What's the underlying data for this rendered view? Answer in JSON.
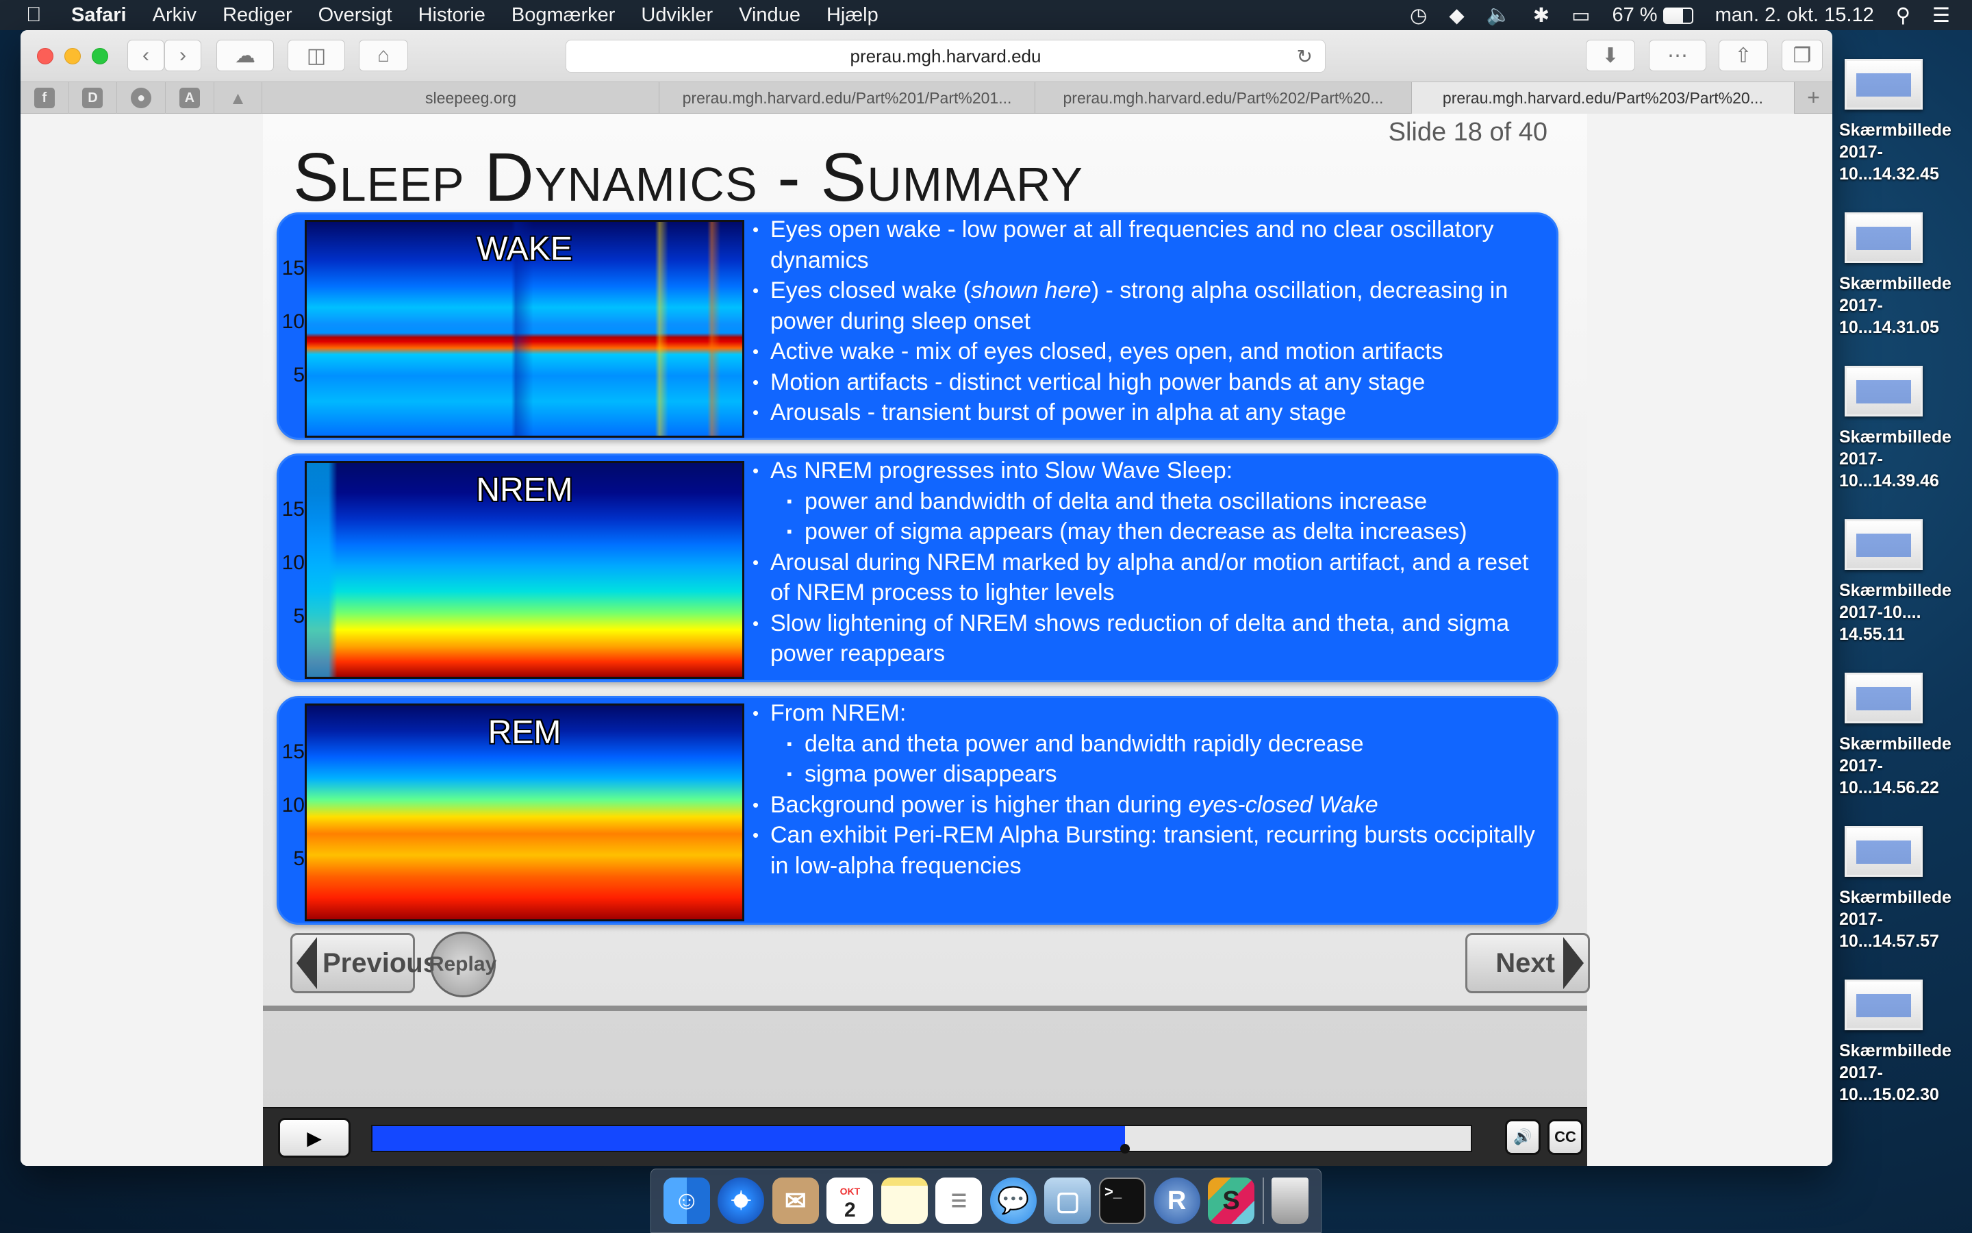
{
  "menubar": {
    "apple": "",
    "app": "Safari",
    "items": [
      "Arkiv",
      "Rediger",
      "Oversigt",
      "Historie",
      "Bogmærker",
      "Udvikler",
      "Vindue",
      "Hjælp"
    ],
    "battery": "67 %",
    "clock": "man. 2. okt. 15.12"
  },
  "browser": {
    "url": "prerau.mgh.harvard.edu",
    "tabs": [
      {
        "label": "sleepeeg.org"
      },
      {
        "label": "prerau.mgh.harvard.edu/Part%201/Part%201..."
      },
      {
        "label": "prerau.mgh.harvard.edu/Part%202/Part%20..."
      },
      {
        "label": "prerau.mgh.harvard.edu/Part%203/Part%20..."
      }
    ],
    "pinned": [
      "f",
      "D",
      "",
      "A",
      ""
    ]
  },
  "slide": {
    "counter": "Slide 18 of 40",
    "title": "Sleep Dynamics - Summary",
    "yticks": [
      "15",
      "10",
      "5"
    ],
    "panels": [
      {
        "label": "WAKE",
        "bullets": [
          {
            "text": "Eyes open wake - low power at all frequencies and no clear oscillatory dynamics"
          },
          {
            "pre": "Eyes closed wake (",
            "em": "shown here",
            "post": ") - strong alpha oscillation, decreasing in power during sleep onset"
          },
          {
            "text": "Active wake - mix of eyes closed, eyes open, and motion artifacts"
          },
          {
            "text": "Motion artifacts - distinct vertical high power bands at any stage"
          },
          {
            "text": "Arousals - transient burst of power in alpha at any stage"
          }
        ]
      },
      {
        "label": "NREM",
        "bullets": [
          {
            "text": "As NREM progresses into Slow Wave Sleep:"
          },
          {
            "text": "power and bandwidth of delta and theta oscillations increase",
            "sub": true
          },
          {
            "text": "power of sigma appears (may then decrease as delta increases)",
            "sub": true
          },
          {
            "text": "Arousal during NREM marked by alpha and/or motion artifact, and a reset of NREM process to lighter levels"
          },
          {
            "text": "Slow lightening of NREM shows reduction of delta and theta, and sigma power reappears"
          }
        ]
      },
      {
        "label": "REM",
        "bullets": [
          {
            "text": "From NREM:"
          },
          {
            "text": "delta and theta power and bandwidth rapidly decrease",
            "sub": true
          },
          {
            "text": "sigma power disappears",
            "sub": true
          },
          {
            "pre": "Background power is higher than during ",
            "em": "eyes-closed Wake",
            "post": ""
          },
          {
            "text": "Can exhibit Peri-REM Alpha Bursting: transient, recurring bursts occipitally in low-alpha frequencies"
          }
        ]
      }
    ],
    "previous_label": "Previous",
    "replay_label": "Replay",
    "next_label": "Next"
  },
  "controls": {
    "progress": 0.685,
    "cc_label": "CC"
  },
  "desktop_icons": [
    {
      "line1": "Skærmbillede",
      "line2": "2017-10...14.32.45"
    },
    {
      "line1": "Skærmbillede",
      "line2": "2017-10...14.31.05"
    },
    {
      "line1": "Skærmbillede",
      "line2": "2017-10...14.39.46"
    },
    {
      "line1": "Skærmbillede",
      "line2": "2017-10.... 14.55.11"
    },
    {
      "line1": "Skærmbillede",
      "line2": "2017-10...14.56.22"
    },
    {
      "line1": "Skærmbillede",
      "line2": "2017-10...14.57.57"
    },
    {
      "line1": "Skærmbillede",
      "line2": "2017-10...15.02.30"
    }
  ],
  "dock": {
    "calendar_month": "OKT",
    "calendar_day": "2",
    "r_label": "R",
    "s_label": "S",
    "terminal_label": ">_"
  },
  "colors": {
    "panel_blue": "#1166ff",
    "progress_blue": "#1448ff"
  }
}
